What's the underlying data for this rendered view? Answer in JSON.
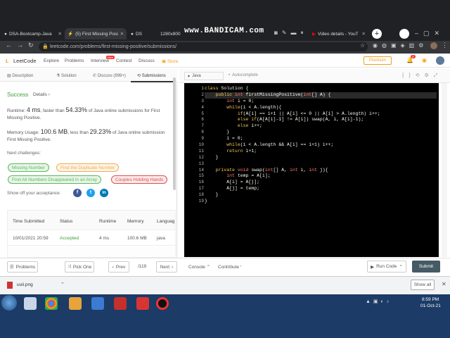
{
  "browser": {
    "tabs": [
      {
        "label": "DSA-Bootcamp-Java",
        "close": "✕"
      },
      {
        "label": "(5) First Missing Posi",
        "close": "✕"
      },
      {
        "label": "DS",
        "close": "✕"
      },
      {
        "label": "1280x800",
        "close": ""
      },
      {
        "label": "Video details - YouT",
        "close": "✕"
      }
    ],
    "watermark": "www.BANDICAM.com",
    "url": "leetcode.com/problems/first-missing-positive/submissions/"
  },
  "leetcode": {
    "brand": "LeetCode",
    "nav": [
      "Explore",
      "Problems",
      "Interview",
      "Contest",
      "Discuss",
      "Store"
    ],
    "new_badge": "New",
    "premium": "Premium",
    "notif_count": "2"
  },
  "left_tabs": [
    "Description",
    "Solution",
    "Discuss (999+)",
    "Submissions"
  ],
  "result": {
    "status": "Success",
    "details": "Details",
    "runtime_prefix": "Runtime:",
    "runtime_value": "4 ms",
    "runtime_mid": ", faster than",
    "runtime_pct": "54.33%",
    "runtime_suffix_1": "of Java online submissions for First",
    "runtime_suffix_2": "Missing Positive.",
    "memory_prefix": "Memory Usage:",
    "memory_value": "100.6 MB",
    "memory_mid": ", less than",
    "memory_pct": "29.23%",
    "memory_suffix_1": "of Java online submission",
    "memory_suffix_2": "First Missing Positive."
  },
  "challenges": {
    "heading": "Next challenges:",
    "items": [
      {
        "label": "Missing Number",
        "color": "#5cb85c"
      },
      {
        "label": "Find the Duplicate Number",
        "color": "#f0ad4e"
      },
      {
        "label": "Find All Numbers Disappeared in an Array",
        "color": "#5cb85c"
      },
      {
        "label": "Couples Holding Hands",
        "color": "#d9534f"
      }
    ]
  },
  "share": {
    "label": "Show off your acceptance:"
  },
  "submissions": {
    "headers": [
      "Time Submitted",
      "Status",
      "Runtime",
      "Memory",
      "Languag"
    ],
    "rows": [
      {
        "time": "10/01/2021 20:59",
        "status": "Accepted",
        "runtime": "4 ms",
        "memory": "100.6 MB",
        "lang": "java"
      }
    ]
  },
  "editor": {
    "language": "Java",
    "autocomplete": "Autocomplete",
    "line_numbers": [
      "1",
      "2",
      "3",
      "4",
      "5",
      "6",
      "7",
      "8",
      "9",
      "10",
      "11",
      "12",
      "13",
      "14",
      "15",
      "16",
      "17",
      "18",
      "19"
    ],
    "lines": [
      "class Solution {",
      "    public int firstMissingPositive(int[] A) {",
      "        int i = 0;",
      "        while(i < A.length){",
      "            if(A[i] == i+1 || A[i] <= 0 || A[i] > A.length) i++;",
      "            else if(A[A[i]-1] != A[i]) swap(A, i, A[i]-1);",
      "            else i++;",
      "        }",
      "        i = 0;",
      "        while(i < A.length && A[i] == i+1) i++;",
      "        return i+1;",
      "    }",
      "",
      "    private void swap(int[] A, int i, int j){",
      "        int temp = A[i];",
      "        A[i] = A[j];",
      "        A[j] = temp;",
      "    }",
      "}"
    ]
  },
  "bottom": {
    "problems": "Problems",
    "pick_one": "Pick One",
    "prev": "Prev",
    "page": "/119",
    "next": "Next",
    "console": "Console",
    "contribute": "Contribute",
    "run_code": "Run Code",
    "submit": "Submit"
  },
  "downloads": {
    "file": "uuii.png",
    "show_all": "Show all"
  },
  "taskbar": {
    "time": "8:59 PM",
    "date": "01-Oct-21"
  }
}
